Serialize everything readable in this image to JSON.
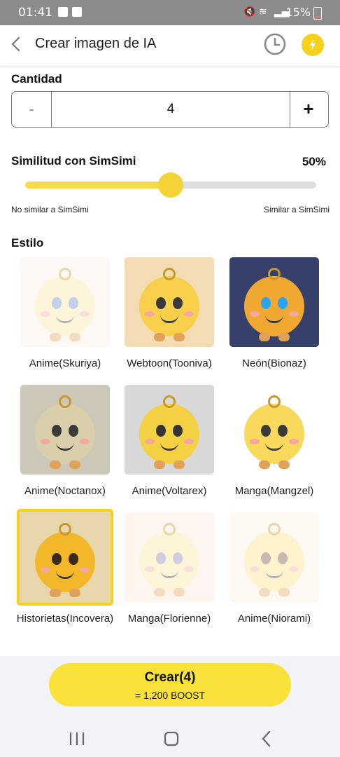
{
  "status": {
    "time": "01:41",
    "battery": "15%"
  },
  "header": {
    "title": "Crear imagen de IA"
  },
  "quantity": {
    "label": "Cantidad",
    "minus": "-",
    "value": "4",
    "plus": "+"
  },
  "similarity": {
    "label": "Similitud con SimSimi",
    "percent_text": "50%",
    "value": 0.5,
    "min_label": "No similar a SimSimi",
    "max_label": "Similar a SimSimi"
  },
  "style_section": {
    "label": "Estilo"
  },
  "styles": [
    {
      "name": "Anime(Skuriya)",
      "bg": "#fdeee6",
      "body": "#fbe7a0",
      "eye": "#5b86c9",
      "faded": true,
      "selected": false
    },
    {
      "name": "Webtoon(Tooniva)",
      "bg": "#f3dcb4",
      "body": "#f7cf4b",
      "eye": "#3a3a3a",
      "faded": false,
      "selected": false
    },
    {
      "name": "Neón(Bionaz)",
      "bg": "#37406b",
      "body": "#f0a830",
      "eye": "#2aa4f0",
      "faded": false,
      "selected": false
    },
    {
      "name": "Anime(Noctanox)",
      "bg": "#cdc7b8",
      "body": "#d9cfaa",
      "eye": "#3a3a3a",
      "faded": false,
      "selected": false
    },
    {
      "name": "Anime(Voltarex)",
      "bg": "#d8d8d8",
      "body": "#f4d142",
      "eye": "#333333",
      "faded": false,
      "selected": false
    },
    {
      "name": "Manga(Mangzel)",
      "bg": "#ffffff",
      "body": "#f8d95b",
      "eye": "#3a3a3a",
      "faded": false,
      "selected": false
    },
    {
      "name": "Historietas(Incoverа)",
      "bg": "#e8d7ad",
      "body": "#f3b82a",
      "eye": "#3a2a1a",
      "faded": false,
      "selected": true
    },
    {
      "name": "Manga(Florienne)",
      "bg": "#fde6dc",
      "body": "#fbe59a",
      "eye": "#8a7bb0",
      "faded": true,
      "selected": false
    },
    {
      "name": "Anime(Niorami)",
      "bg": "#fdeede",
      "body": "#fbe07b",
      "eye": "#6b4a3a",
      "faded": true,
      "selected": false
    }
  ],
  "create": {
    "label": "Crear(4)",
    "cost": "= 1,200 BOOST"
  },
  "colors": {
    "accent": "#f5d338",
    "button": "#fbe23b",
    "track": "#dedede"
  }
}
